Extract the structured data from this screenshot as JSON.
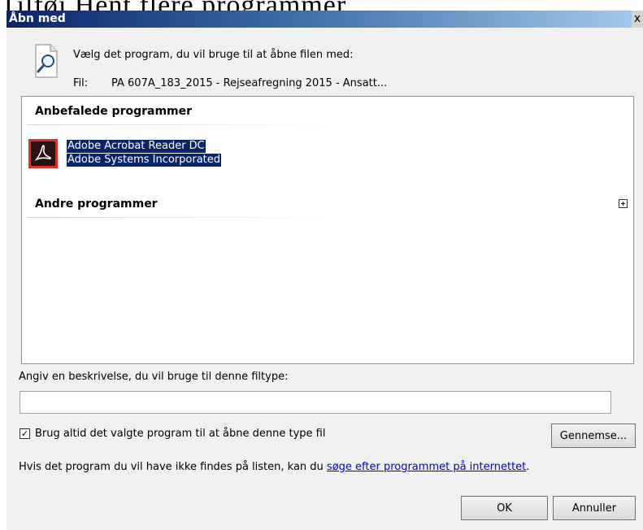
{
  "background_text": "Tilføj Hent flere programmer...",
  "dialog": {
    "title": "Åbn med",
    "close_glyph": "x",
    "prompt": "Vælg det program, du vil bruge til at åbne filen med:",
    "file_label": "Fil:",
    "file_name": "PA 607A_183_2015 - Rejseafregning 2015 - Ansatt..."
  },
  "list": {
    "recommended_header": "Anbefalede programmer",
    "other_header": "Andre programmer",
    "selected_app": {
      "name": "Adobe Acrobat Reader DC",
      "vendor": "Adobe Systems Incorporated",
      "icon": "adobe-acrobat-icon"
    }
  },
  "description": {
    "label": "Angiv en beskrivelse, du vil bruge til denne filtype:",
    "value": ""
  },
  "always_use": {
    "checked": true,
    "check_glyph": "✓",
    "label": "Brug altid det valgte program til at åbne denne type fil"
  },
  "browse_label": "Gennemse...",
  "hint": {
    "prefix": "Hvis det program du vil have ikke findes på listen, kan du ",
    "link": "søge efter programmet på internettet",
    "suffix": "."
  },
  "buttons": {
    "ok": "OK",
    "cancel": "Annuller"
  },
  "colors": {
    "selection": "#0a246a",
    "link": "#0000cc",
    "acrobat_red": "#e03024"
  }
}
